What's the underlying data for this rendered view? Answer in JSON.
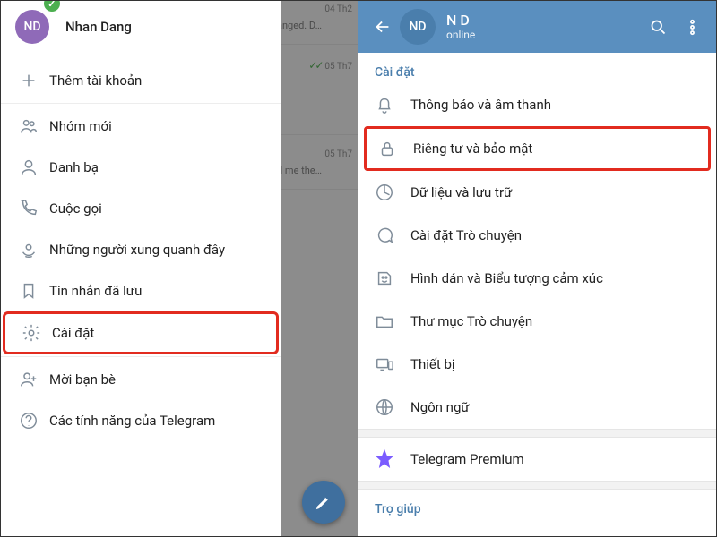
{
  "left": {
    "avatar_initials": "ND",
    "username": "Nhan Dang",
    "add_account": "Thêm tài khoản",
    "new_group": "Nhóm mới",
    "contacts": "Danh bạ",
    "calls": "Cuộc gọi",
    "people_nearby": "Những người xung quanh đây",
    "saved_messages": "Tin nhắn đã lưu",
    "settings": "Cài đặt",
    "invite_friends": "Mời bạn bè",
    "telegram_features": "Các tính năng của Telegram",
    "chat_ts1": "04 Th2",
    "chat_msg1": "anged. D…",
    "chat_ts2": "05 Th7",
    "chat_ts3": "05 Th7",
    "chat_msg3": "d me the…"
  },
  "right": {
    "avatar_initials": "ND",
    "title": "N D",
    "status": "online",
    "section": "Cài đặt",
    "notifications": "Thông báo và âm thanh",
    "privacy": "Riêng tư và bảo mật",
    "data": "Dữ liệu và lưu trữ",
    "chat_settings": "Cài đặt Trò chuyện",
    "stickers": "Hình dán và Biểu tượng cảm xúc",
    "folders": "Thư mục Trò chuyện",
    "devices": "Thiết bị",
    "language": "Ngôn ngữ",
    "premium": "Telegram Premium",
    "help_section": "Trợ giúp"
  }
}
